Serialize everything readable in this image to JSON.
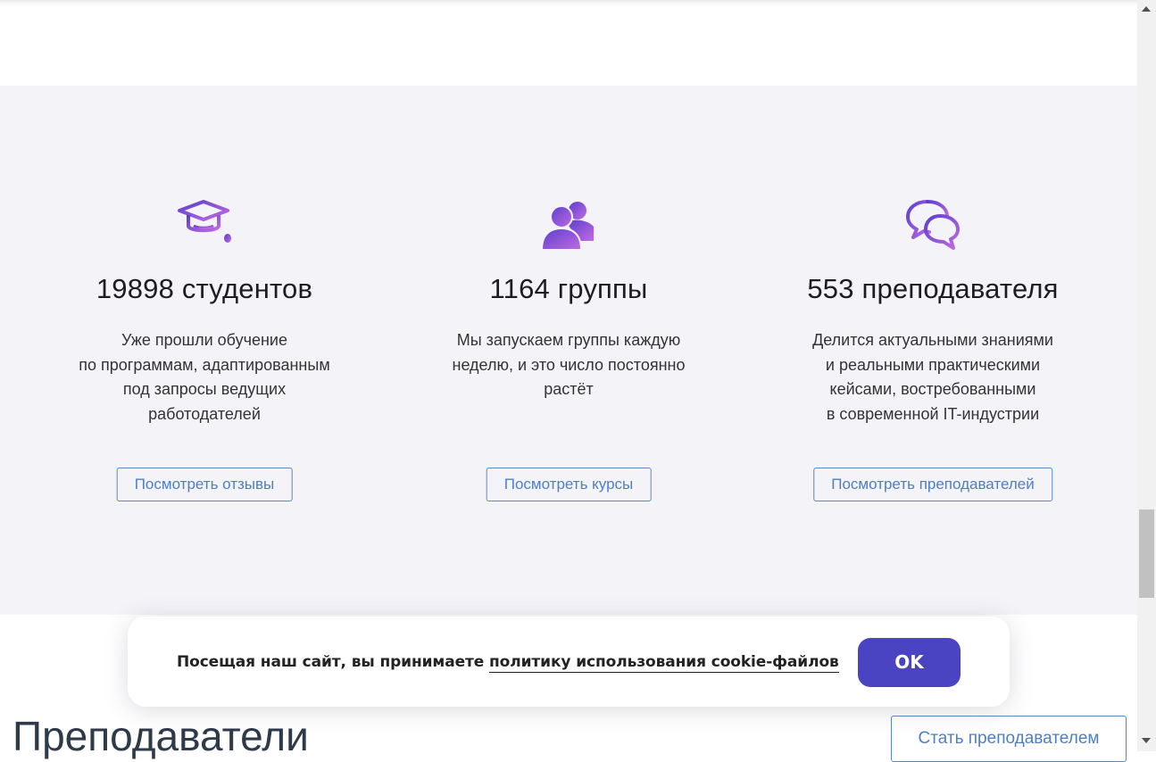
{
  "stats": [
    {
      "icon": "graduation-cap-icon",
      "title": "19898 студентов",
      "description_lines": [
        "Уже прошли обучение",
        "по программам, адаптированным",
        "под запросы ведущих",
        "работодателей"
      ],
      "button": "Посмотреть отзывы"
    },
    {
      "icon": "users-group-icon",
      "title": "1164 группы",
      "description_lines": [
        "Мы запускаем группы каждую",
        "неделю, и это число постоянно",
        "растёт"
      ],
      "button": "Посмотреть курсы"
    },
    {
      "icon": "chat-bubbles-icon",
      "title": "553 преподавателя",
      "description_lines": [
        "Делится актуальными знаниями",
        "и реальными практическими",
        "кейсами, востребованными",
        "в современной IT-индустрии"
      ],
      "button": "Посмотреть преподавателей"
    }
  ],
  "section": {
    "title": "Преподаватели",
    "become_button": "Стать преподавателем"
  },
  "cookie": {
    "text": "Посещая наш сайт, вы принимаете ",
    "link": "политику использования cookie-файлов",
    "ok": "OK"
  },
  "colors": {
    "accent_purple": "#4a43c2",
    "icon_gradient_start": "#5b3fcf",
    "icon_gradient_end": "#c06be0",
    "button_blue": "#4e7fc6",
    "section_bg": "#f4f3f8"
  }
}
